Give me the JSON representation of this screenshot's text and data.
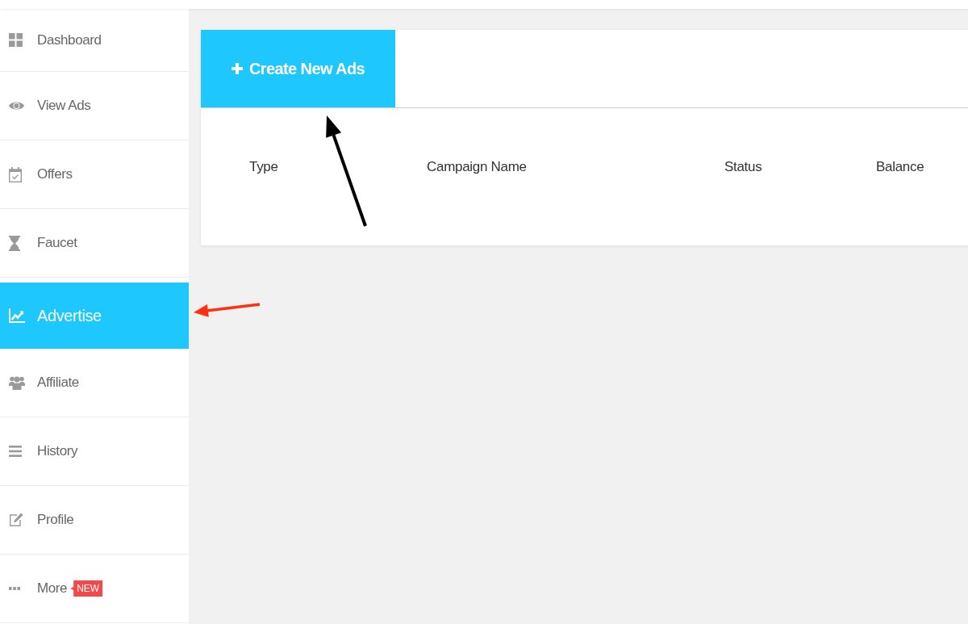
{
  "sidebar": {
    "items": [
      {
        "label": "Dashboard",
        "selected": false
      },
      {
        "label": "View Ads",
        "selected": false
      },
      {
        "label": "Offers",
        "selected": false
      },
      {
        "label": "Faucet",
        "selected": false
      },
      {
        "label": "Advertise",
        "selected": true
      },
      {
        "label": "Affiliate",
        "selected": false
      },
      {
        "label": "History",
        "selected": false
      },
      {
        "label": "Profile",
        "selected": false
      },
      {
        "label": "More",
        "selected": false,
        "badge": "NEW"
      }
    ]
  },
  "create_button": {
    "label": "Create New Ads"
  },
  "table": {
    "columns": [
      "Type",
      "Campaign Name",
      "Status",
      "Balance"
    ]
  },
  "annotations": [
    {
      "kind": "up",
      "color": "#000000"
    },
    {
      "kind": "left",
      "color": "#ff3010"
    }
  ]
}
